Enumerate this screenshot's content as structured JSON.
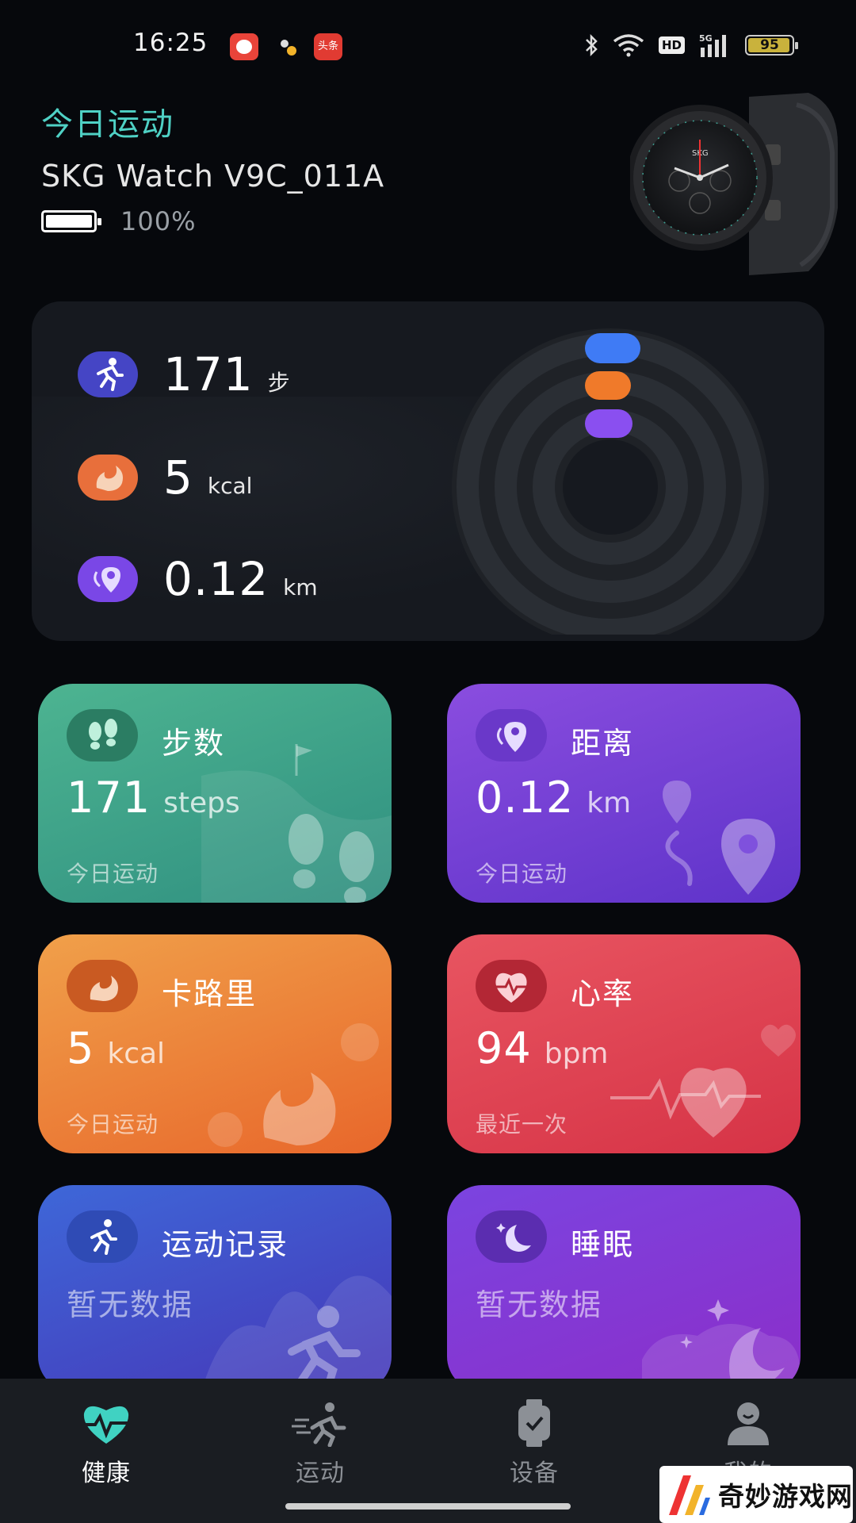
{
  "status_bar": {
    "time": "16:25",
    "app3_label": "头条",
    "hd": "HD",
    "battery": "95"
  },
  "header": {
    "title": "今日运动",
    "device_name": "SKG Watch V9C_011A",
    "device_battery": "100%"
  },
  "summary": {
    "steps": {
      "value": "171",
      "unit": "步"
    },
    "calories": {
      "value": "5",
      "unit": "kcal"
    },
    "distance": {
      "value": "0.12",
      "unit": "km"
    },
    "ring_colors": [
      "#3f7bf5",
      "#f07a2a",
      "#8a4ff0"
    ]
  },
  "tiles": {
    "steps": {
      "title": "步数",
      "value": "171",
      "unit": "steps",
      "sub": "今日运动"
    },
    "distance": {
      "title": "距离",
      "value": "0.12",
      "unit": "km",
      "sub": "今日运动"
    },
    "calories": {
      "title": "卡路里",
      "value": "5",
      "unit": "kcal",
      "sub": "今日运动"
    },
    "heart_rate": {
      "title": "心率",
      "value": "94",
      "unit": "bpm",
      "sub": "最近一次"
    },
    "workout": {
      "title": "运动记录",
      "nodata": "暂无数据"
    },
    "sleep": {
      "title": "睡眠",
      "nodata": "暂无数据"
    }
  },
  "nav": {
    "items": [
      {
        "label": "健康",
        "icon": "heart-pulse-icon",
        "active": true
      },
      {
        "label": "运动",
        "icon": "running-icon",
        "active": false
      },
      {
        "label": "设备",
        "icon": "watch-icon",
        "active": false
      },
      {
        "label": "我的",
        "icon": "profile-icon",
        "active": false
      }
    ]
  },
  "watermark": {
    "text": "奇妙游戏网"
  },
  "colors": {
    "accent": "#4fd1c5",
    "steps_tile": "#4db491",
    "distance_tile": "#8a4ddf",
    "calories_tile": "#f0a04a",
    "heart_tile": "#e85561",
    "workout_tile": "#3e67d8",
    "sleep_tile": "#7b44e0"
  }
}
